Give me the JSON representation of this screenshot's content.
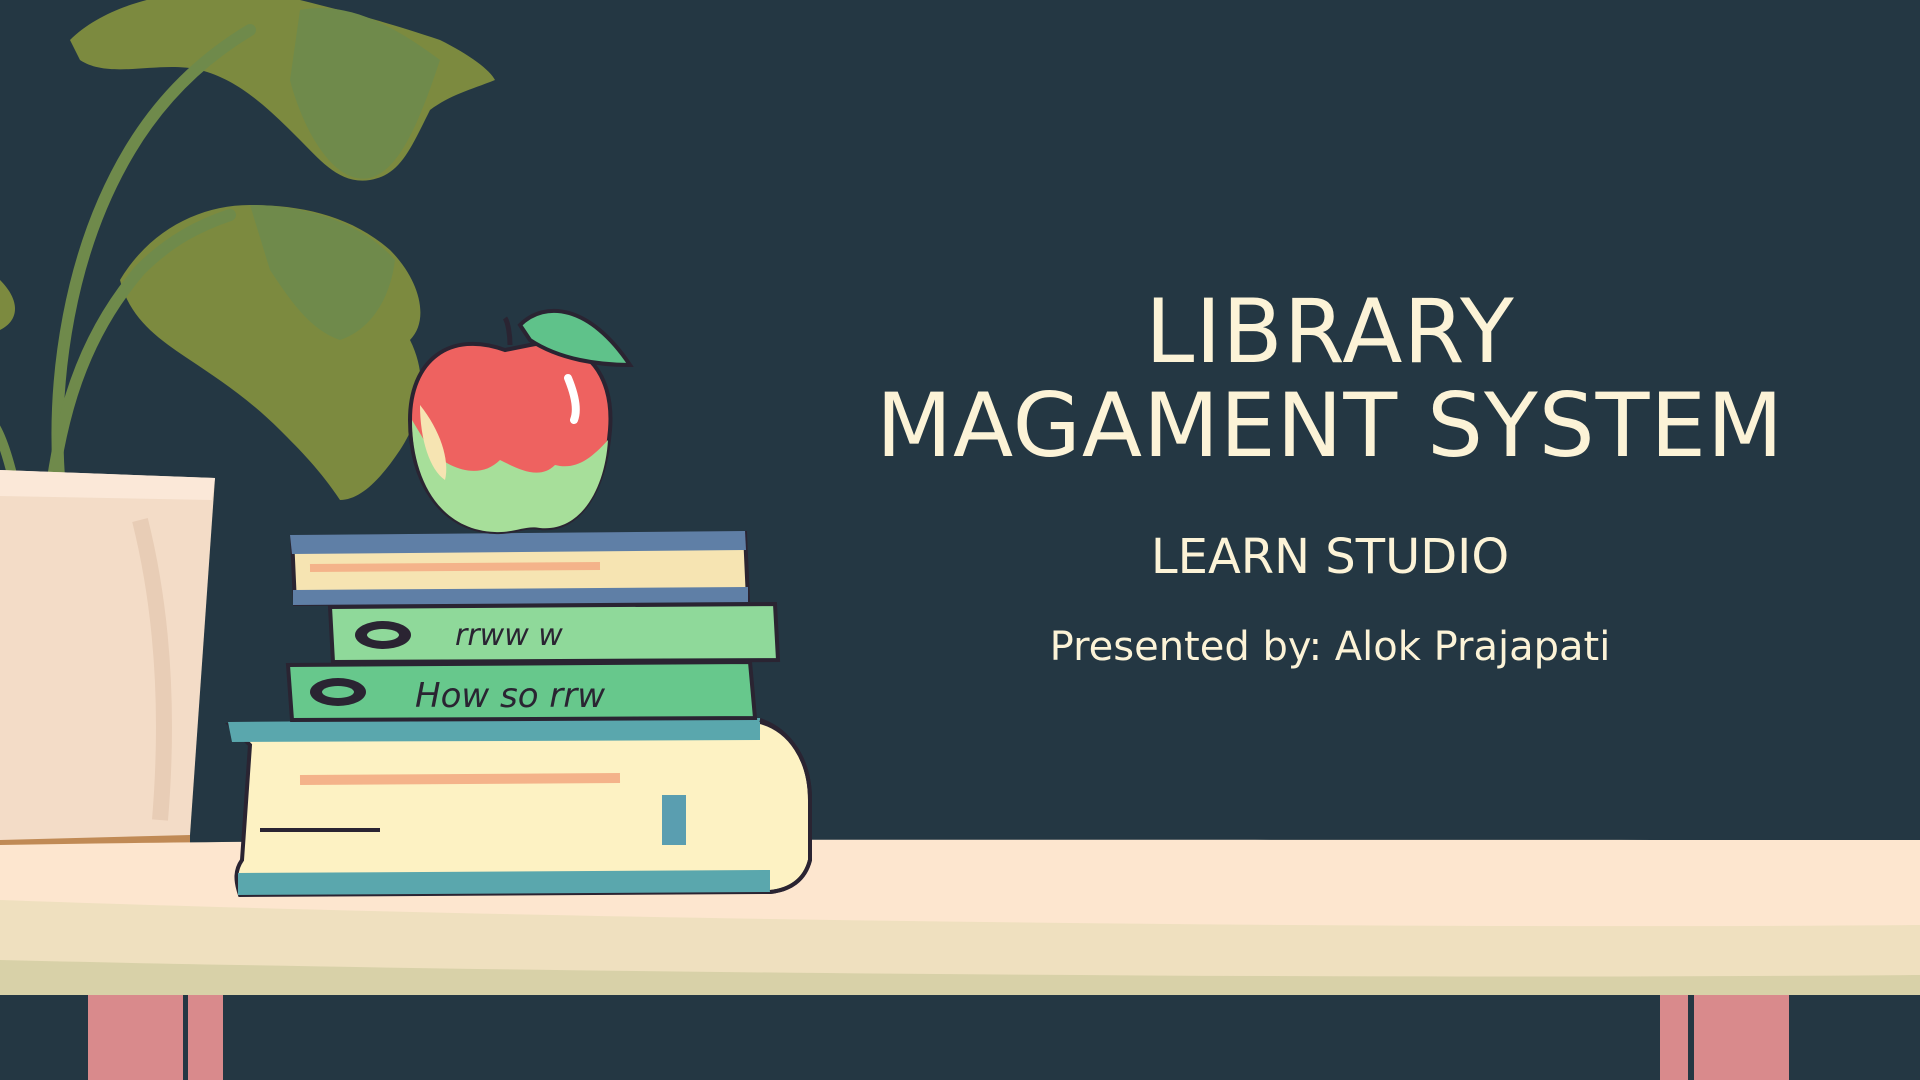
{
  "slide": {
    "title_line1": "LIBRARY",
    "title_line2": "MAGAMENT SYSTEM",
    "subtitle": "LEARN STUDIO",
    "presenter": "Presented by: Alok Prajapati"
  },
  "illustration": {
    "book2_spine_text": "rrww w",
    "book3_spine_text": "How so rrw",
    "icons": [
      "plant-icon",
      "flower-pot-icon",
      "apple-icon",
      "book-stack-icon",
      "table-icon"
    ]
  },
  "colors": {
    "background": "#243743",
    "title_text": "#fcf3d7",
    "table_top": "#fde6cf",
    "table_legs": "#d98a8c",
    "apple_red": "#ee6260",
    "leaf_green": "#7c8a3f"
  }
}
